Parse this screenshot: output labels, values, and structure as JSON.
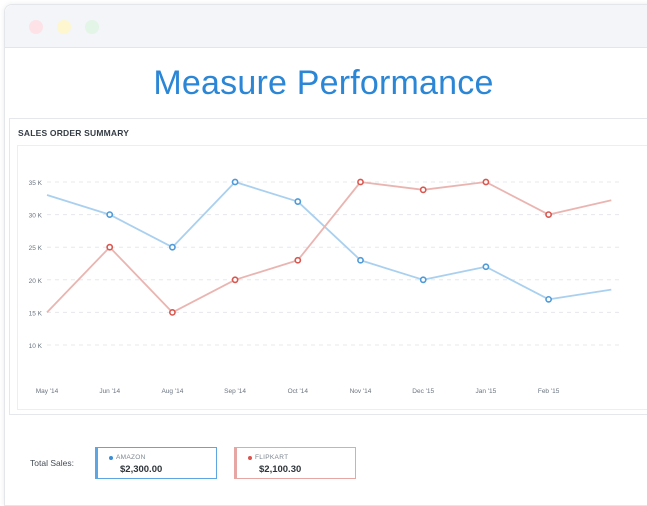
{
  "window": {
    "controls": [
      {
        "name": "close",
        "color": "#fde3e8"
      },
      {
        "name": "minimize",
        "color": "#fdf6cf"
      },
      {
        "name": "maximize",
        "color": "#e3f5e6"
      }
    ]
  },
  "headline": "Measure Performance",
  "panel_title": "SALES ORDER SUMMARY",
  "totals": {
    "label": "Total Sales:",
    "cards": [
      {
        "name": "AMAZON",
        "value": "$2,300.00",
        "color": "#3a8fd6",
        "border": "#5ea6e2"
      },
      {
        "name": "FLIPKART",
        "value": "$2,100.30",
        "color": "#d9534f",
        "border": "#e6a6a3"
      }
    ]
  },
  "chart_data": {
    "type": "line",
    "categories": [
      "May '14",
      "Jun '14",
      "Aug '14",
      "Sep '14",
      "Oct '14",
      "Nov '14",
      "Dec '15",
      "Jan '15",
      "Feb '15"
    ],
    "yticks": [
      "10 K",
      "15 K",
      "20 K",
      "25 K",
      "30 K",
      "35 K"
    ],
    "ylim": [
      10000,
      35000
    ],
    "grid": true,
    "series": [
      {
        "name": "AMAZON",
        "color": "#a9d0ef",
        "marker": "#4f9ad8",
        "values": [
          33000,
          30000,
          25000,
          35000,
          32000,
          23000,
          20000,
          22000,
          17000,
          18500
        ]
      },
      {
        "name": "FLIPKART",
        "color": "#eab5b1",
        "marker": "#d9574f",
        "values": [
          15000,
          25000,
          15000,
          20000,
          23000,
          35000,
          33800,
          35000,
          30000,
          32200
        ]
      }
    ]
  }
}
